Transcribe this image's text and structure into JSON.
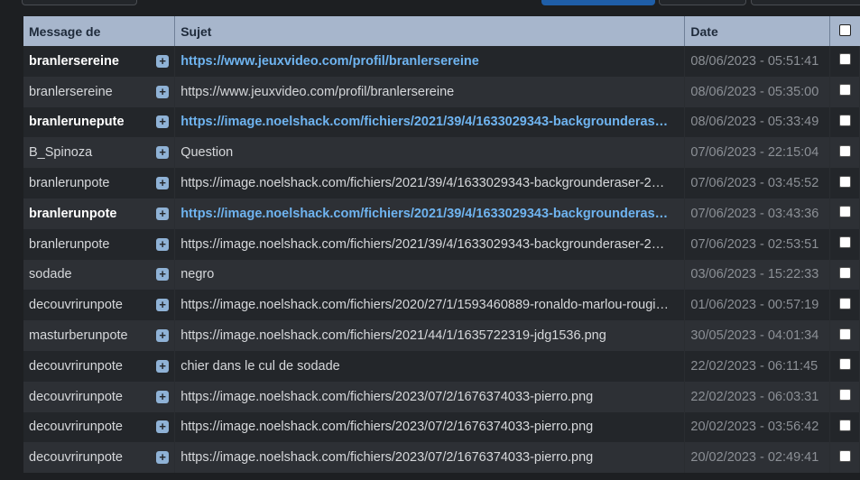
{
  "headers": {
    "from": "Message de",
    "subject": "Sujet",
    "date": "Date"
  },
  "rows": [
    {
      "from": "branlersereine",
      "subject": "https://www.jeuxvideo.com/profil/branlersereine",
      "date": "08/06/2023 - 05:51:41",
      "unread": true
    },
    {
      "from": "branlersereine",
      "subject": "https://www.jeuxvideo.com/profil/branlersereine",
      "date": "08/06/2023 - 05:35:00",
      "unread": false
    },
    {
      "from": "branlerunepute",
      "subject": "https://image.noelshack.com/fichiers/2021/39/4/1633029343-backgrounderas…",
      "date": "08/06/2023 - 05:33:49",
      "unread": true
    },
    {
      "from": "B_Spinoza",
      "subject": "Question",
      "date": "07/06/2023 - 22:15:04",
      "unread": false
    },
    {
      "from": "branlerunpote",
      "subject": "https://image.noelshack.com/fichiers/2021/39/4/1633029343-backgrounderaser-2…",
      "date": "07/06/2023 - 03:45:52",
      "unread": false
    },
    {
      "from": "branlerunpote",
      "subject": "https://image.noelshack.com/fichiers/2021/39/4/1633029343-backgrounderas…",
      "date": "07/06/2023 - 03:43:36",
      "unread": true
    },
    {
      "from": "branlerunpote",
      "subject": "https://image.noelshack.com/fichiers/2021/39/4/1633029343-backgrounderaser-2…",
      "date": "07/06/2023 - 02:53:51",
      "unread": false
    },
    {
      "from": "sodade",
      "subject": "negro",
      "date": "03/06/2023 - 15:22:33",
      "unread": false
    },
    {
      "from": "decouvrirunpote",
      "subject": "https://image.noelshack.com/fichiers/2020/27/1/1593460889-ronaldo-marlou-rougi…",
      "date": "01/06/2023 - 00:57:19",
      "unread": false
    },
    {
      "from": "masturberunpote",
      "subject": "https://image.noelshack.com/fichiers/2021/44/1/1635722319-jdg1536.png",
      "date": "30/05/2023 - 04:01:34",
      "unread": false
    },
    {
      "from": "decouvrirunpote",
      "subject": "chier dans le cul de sodade",
      "date": "22/02/2023 - 06:11:45",
      "unread": false
    },
    {
      "from": "decouvrirunpote",
      "subject": "https://image.noelshack.com/fichiers/2023/07/2/1676374033-pierro.png",
      "date": "22/02/2023 - 06:03:31",
      "unread": false
    },
    {
      "from": "decouvrirunpote",
      "subject": "https://image.noelshack.com/fichiers/2023/07/2/1676374033-pierro.png",
      "date": "20/02/2023 - 03:56:42",
      "unread": false
    },
    {
      "from": "decouvrirunpote",
      "subject": "https://image.noelshack.com/fichiers/2023/07/2/1676374033-pierro.png",
      "date": "20/02/2023 - 02:49:41",
      "unread": false
    }
  ],
  "icons": {
    "expand": "plus-square-icon",
    "select": "checkbox"
  },
  "colors": {
    "header_bg": "#a7b6cc",
    "unread_link": "#6fb4f0",
    "row_odd": "#23262a",
    "row_even": "#2d3035",
    "date_text": "#8c9096"
  }
}
